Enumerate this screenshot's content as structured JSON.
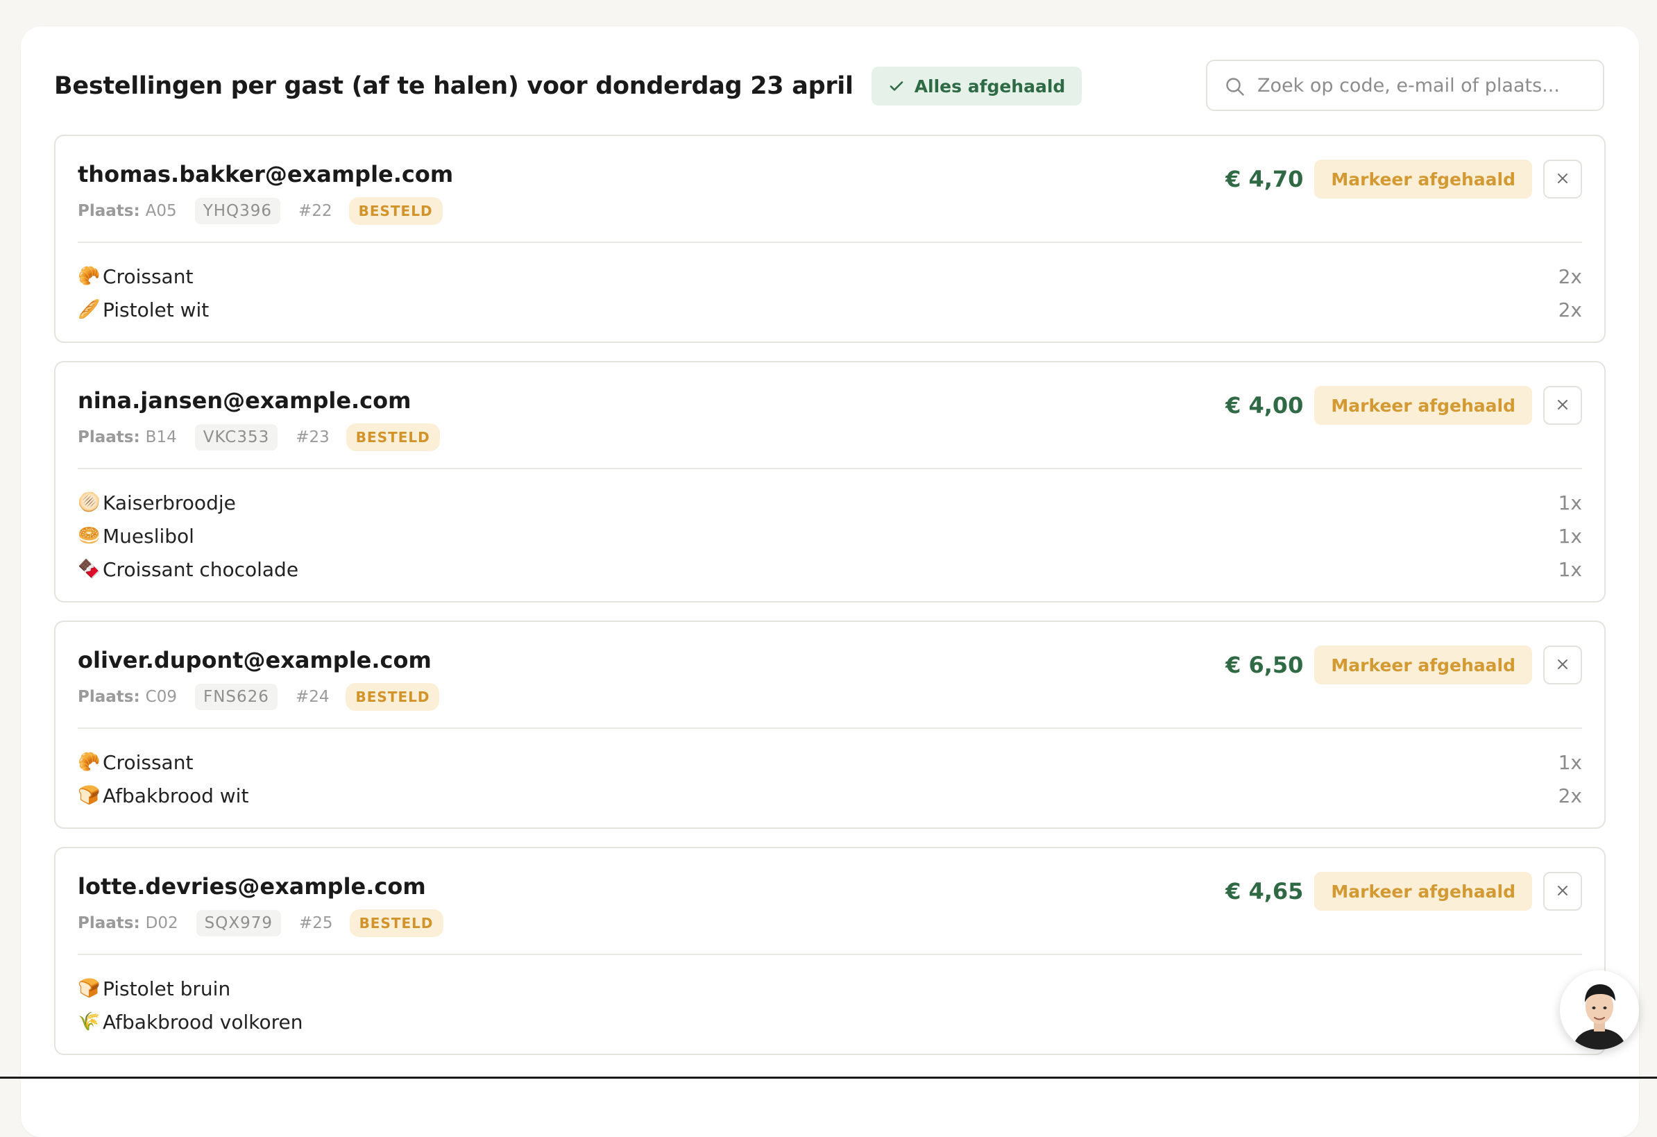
{
  "header": {
    "title": "Bestellingen per gast (af te halen) voor donderdag 23 april",
    "all_done_badge": "Alles afgehaald"
  },
  "search": {
    "placeholder": "Zoek op code, e-mail of plaats..."
  },
  "labels": {
    "plaats": "Plaats:",
    "mark_picked_up": "Markeer afgehaald"
  },
  "orders": [
    {
      "email": "thomas.bakker@example.com",
      "plaats": "A05",
      "code": "YHQ396",
      "number": "#22",
      "status": "BESTELD",
      "total": "€ 4,70",
      "items": [
        {
          "icon": "🥐",
          "name": "Croissant",
          "qty": "2x"
        },
        {
          "icon": "🥖",
          "name": "Pistolet wit",
          "qty": "2x"
        }
      ]
    },
    {
      "email": "nina.jansen@example.com",
      "plaats": "B14",
      "code": "VKC353",
      "number": "#23",
      "status": "BESTELD",
      "total": "€ 4,00",
      "items": [
        {
          "icon": "🫓",
          "name": "Kaiserbroodje",
          "qty": "1x"
        },
        {
          "icon": "🥯",
          "name": "Mueslibol",
          "qty": "1x"
        },
        {
          "icon": "🍫",
          "name": "Croissant chocolade",
          "qty": "1x"
        }
      ]
    },
    {
      "email": "oliver.dupont@example.com",
      "plaats": "C09",
      "code": "FNS626",
      "number": "#24",
      "status": "BESTELD",
      "total": "€ 6,50",
      "items": [
        {
          "icon": "🥐",
          "name": "Croissant",
          "qty": "1x"
        },
        {
          "icon": "🍞",
          "name": "Afbakbrood wit",
          "qty": "2x"
        }
      ]
    },
    {
      "email": "lotte.devries@example.com",
      "plaats": "D02",
      "code": "SQX979",
      "number": "#25",
      "status": "BESTELD",
      "total": "€ 4,65",
      "items": [
        {
          "icon": "🍞",
          "name": "Pistolet bruin",
          "qty": ""
        },
        {
          "icon": "🌾",
          "name": "Afbakbrood volkoren",
          "qty": ""
        }
      ]
    }
  ],
  "colors": {
    "accent_green": "#2f6a45",
    "badge_green_bg": "#e6f1ea",
    "status_orange": "#d1932a",
    "status_orange_bg": "#fcefd7"
  }
}
